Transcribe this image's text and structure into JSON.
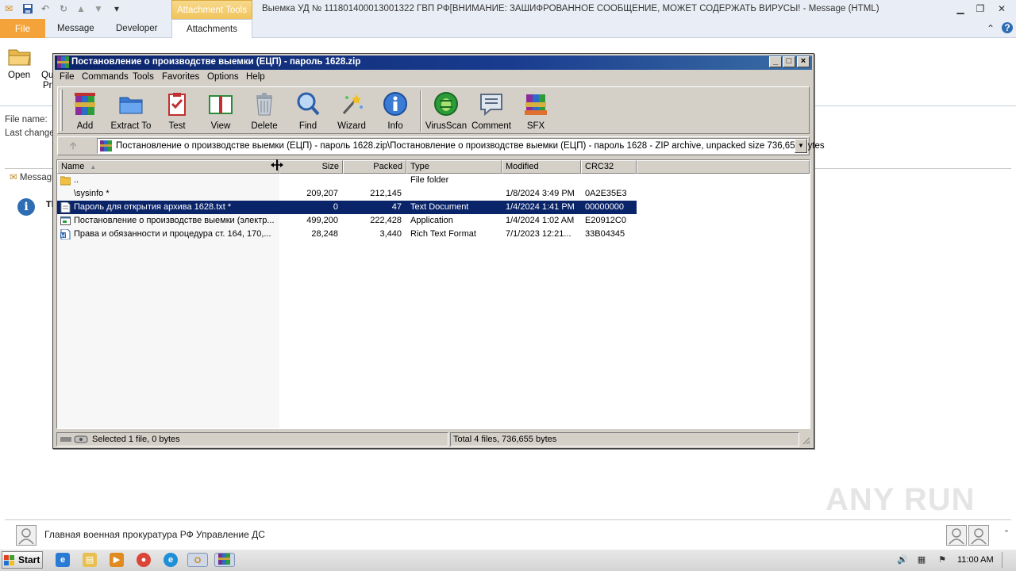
{
  "outlook": {
    "title": "Выемка УД № 111801400013001322  ГВП РФ[ВНИМАНИЕ: ЗАШИФРОВАННОЕ СООБЩЕНИЕ, МОЖЕТ СОДЕРЖАТЬ ВИРУСЫ!  -  Message (HTML)",
    "contextual_tab": "Attachment Tools",
    "tabs": {
      "file": "File",
      "message": "Message",
      "developer": "Developer",
      "attachments": "Attachments"
    },
    "ribbon": {
      "open": "Open",
      "quick_print_1": "Qu",
      "quick_print_2": "Pri"
    },
    "header": {
      "file_name_label": "File name:",
      "last_change_label": "Last change"
    },
    "message_tab": "Messag",
    "info_text": "Tl",
    "people_pane": "Главная военная прокуратура РФ Управление ДС"
  },
  "rar": {
    "title": "Постановление о производстве выемки (ЕЦП) - пароль 1628.zip",
    "menu": [
      "File",
      "Commands",
      "Tools",
      "Favorites",
      "Options",
      "Help"
    ],
    "toolbar": [
      "Add",
      "Extract To",
      "Test",
      "View",
      "Delete",
      "Find",
      "Wizard",
      "Info",
      "VirusScan",
      "Comment",
      "SFX"
    ],
    "path": "Постановление о производстве выемки (ЕЦП) - пароль 1628.zip\\Постановление о производстве выемки (ЕЦП) - пароль 1628 - ZIP archive, unpacked size 736,655 bytes",
    "columns": {
      "name": "Name",
      "size": "Size",
      "packed": "Packed",
      "type": "Type",
      "modified": "Modified",
      "crc": "CRC32"
    },
    "files": [
      {
        "name": "..",
        "size": "",
        "packed": "",
        "type": "File folder",
        "modified": "",
        "crc": ""
      },
      {
        "name": "\\sysinfo *",
        "size": "209,207",
        "packed": "212,145",
        "type": "",
        "modified": "1/8/2024 3:49 PM",
        "crc": "0A2E35E3"
      },
      {
        "name": "Пароль для открытия архива 1628.txt *",
        "size": "0",
        "packed": "47",
        "type": "Text Document",
        "modified": "1/4/2024 1:41 PM",
        "crc": "00000000"
      },
      {
        "name": "Постановление о производстве выемки (электр...",
        "size": "499,200",
        "packed": "222,428",
        "type": "Application",
        "modified": "1/4/2024 1:02 AM",
        "crc": "E20912C0"
      },
      {
        "name": "Права и обязанности и процедура ст. 164, 170,...",
        "size": "28,248",
        "packed": "3,440",
        "type": "Rich Text Format",
        "modified": "7/1/2023 12:21...",
        "crc": "33B04345"
      }
    ],
    "status_left": "Selected 1 file, 0 bytes",
    "status_right": "Total 4 files, 736,655 bytes"
  },
  "taskbar": {
    "start": "Start",
    "clock": "11:00 AM"
  },
  "watermark": "ANY RUN"
}
